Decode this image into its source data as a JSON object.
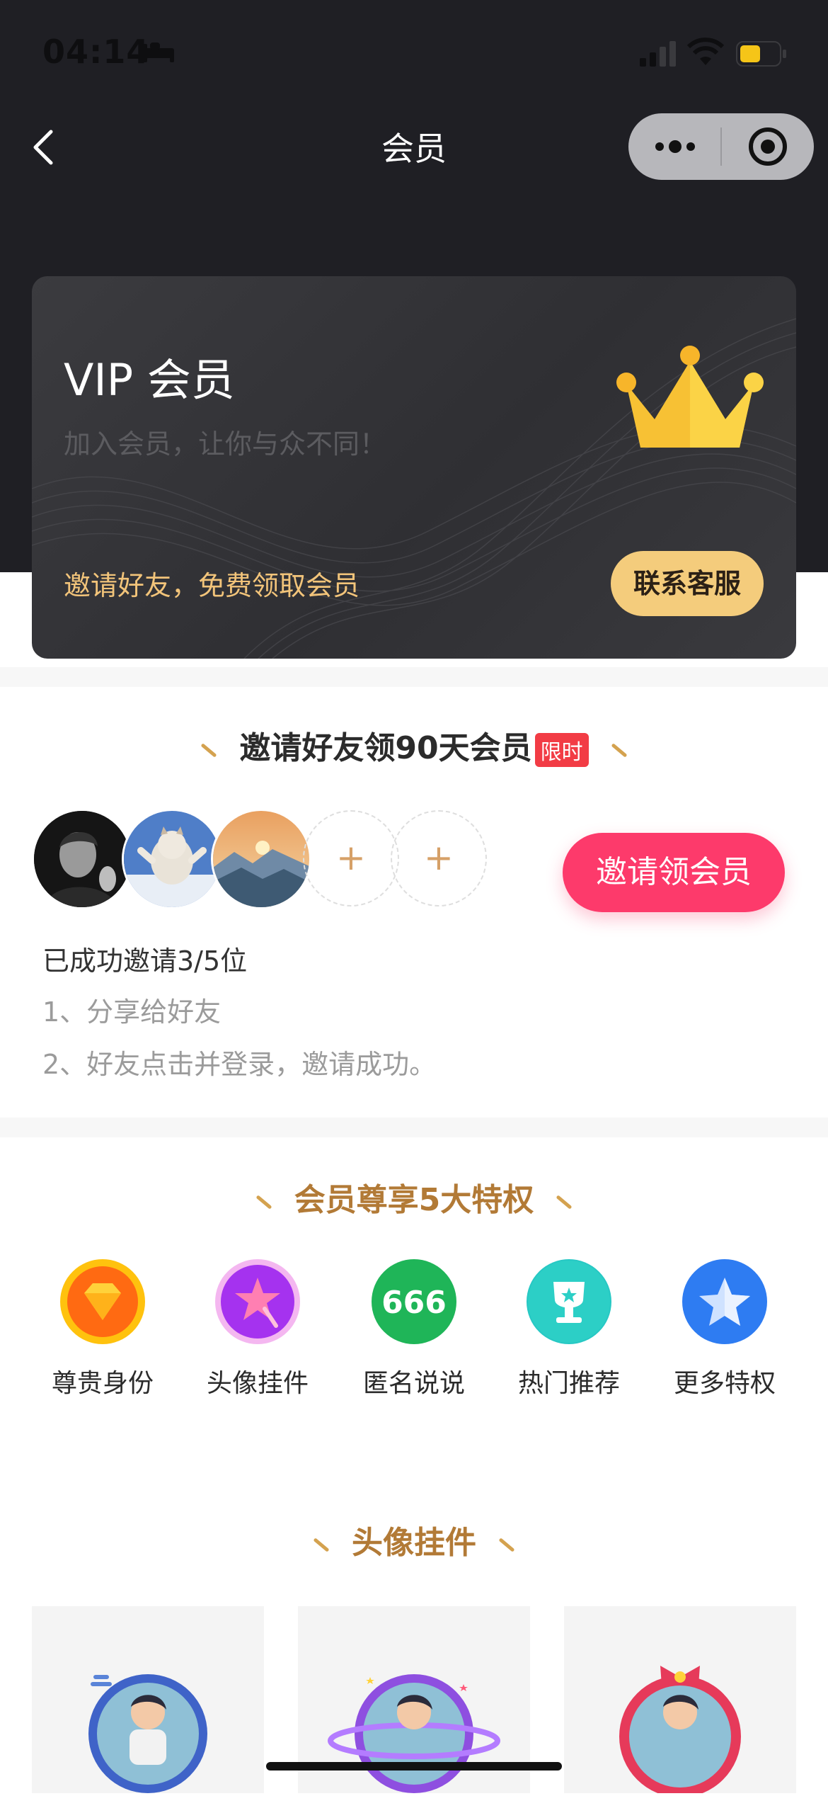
{
  "status_bar": {
    "time": "04:14",
    "icons": [
      "bed-icon",
      "cellular-signal-icon",
      "wifi-icon",
      "battery-icon"
    ]
  },
  "nav": {
    "title": "会员",
    "back_icon": "chevron-left-icon",
    "capsule_icons": [
      "more-dots-icon",
      "close-target-icon"
    ]
  },
  "vip_card": {
    "title": "VIP 会员",
    "subtitle": "加入会员，让你与众不同！",
    "invite_text": "邀请好友，免费领取会员",
    "contact_button": "联系客服",
    "icon": "crown-icon",
    "colors": {
      "card": "#333337",
      "gold": "#f4cc7c",
      "crown": "#f7c134"
    }
  },
  "invite": {
    "title": "邀请好友领90天会员",
    "tag": "限时",
    "invite_button": "邀请领会员",
    "avatars": [
      "man-portrait-avatar",
      "cat-avatar",
      "mountain-sunset-avatar"
    ],
    "empty_slot_label": "+",
    "progress_text": "已成功邀请3/5位",
    "steps": [
      "1、分享给好友",
      "2、好友点击并登录，邀请成功。"
    ],
    "colors": {
      "button": "#fd3a6b",
      "tag": "#f23c45"
    }
  },
  "privileges": {
    "title": "会员尊享5大特权",
    "items": [
      {
        "label": "尊贵身份",
        "icon": "diamond-icon",
        "color": "#ff7a1a"
      },
      {
        "label": "头像挂件",
        "icon": "star-wand-icon",
        "color": "#b33cf0"
      },
      {
        "label": "匿名说说",
        "icon": "666-badge-icon",
        "icon_text": "666",
        "color": "#1fb558"
      },
      {
        "label": "热门推荐",
        "icon": "trophy-icon",
        "color": "#27c8c4"
      },
      {
        "label": "更多特权",
        "icon": "star-icon",
        "color": "#2e7cf2"
      }
    ]
  },
  "frames": {
    "title": "头像挂件",
    "items": [
      "blue-wave-frame",
      "purple-planet-frame",
      "red-bow-frame"
    ]
  }
}
